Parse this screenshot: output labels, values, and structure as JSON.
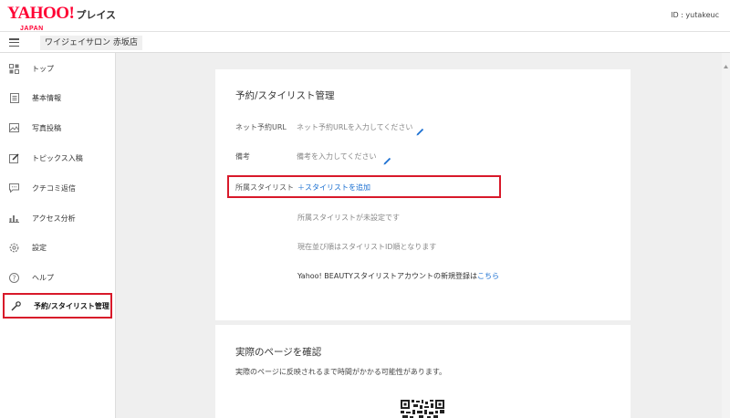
{
  "header": {
    "logo_text": "YAHOO!",
    "logo_sub": "JAPAN",
    "service_name": "プレイス",
    "user_id": "ID : yutakeuc"
  },
  "subheader": {
    "shop_name": "ワイジェイサロン 赤坂店"
  },
  "sidebar": {
    "items": [
      {
        "label": "トップ",
        "icon": "dashboard-icon"
      },
      {
        "label": "基本情報",
        "icon": "document-icon"
      },
      {
        "label": "写真投稿",
        "icon": "image-icon"
      },
      {
        "label": "トピックス入稿",
        "icon": "edit-icon"
      },
      {
        "label": "クチコミ返信",
        "icon": "comment-icon"
      },
      {
        "label": "アクセス分析",
        "icon": "bar-chart-icon"
      },
      {
        "label": "設定",
        "icon": "gear-icon"
      },
      {
        "label": "ヘルプ",
        "icon": "help-icon"
      },
      {
        "label": "予約/スタイリスト管理",
        "icon": "wrench-icon",
        "active": true
      }
    ]
  },
  "main": {
    "title": "予約/スタイリスト管理",
    "net_reservation": {
      "label": "ネット予約URL",
      "placeholder": "ネット予約URLを入力してください"
    },
    "memo": {
      "label": "備考",
      "placeholder": "備考を入力してください"
    },
    "stylists": {
      "label": "所属スタイリスト",
      "add_link": "＋スタイリストを追加",
      "empty_message": "所属スタイリストが未設定です",
      "order_message": "現在並び順はスタイリストID順となります",
      "beauty_note_prefix": "Yahoo! BEAUTYスタイリストアカウントの新規登録は",
      "beauty_note_link": "こちら"
    }
  },
  "preview": {
    "title": "実際のページを確認",
    "description": "実際のページに反映されるまで時間がかかる可能性があります。"
  },
  "colors": {
    "brand_red": "#ff0033",
    "highlight_red": "#d8192a",
    "link_blue": "#1a6fd1"
  }
}
